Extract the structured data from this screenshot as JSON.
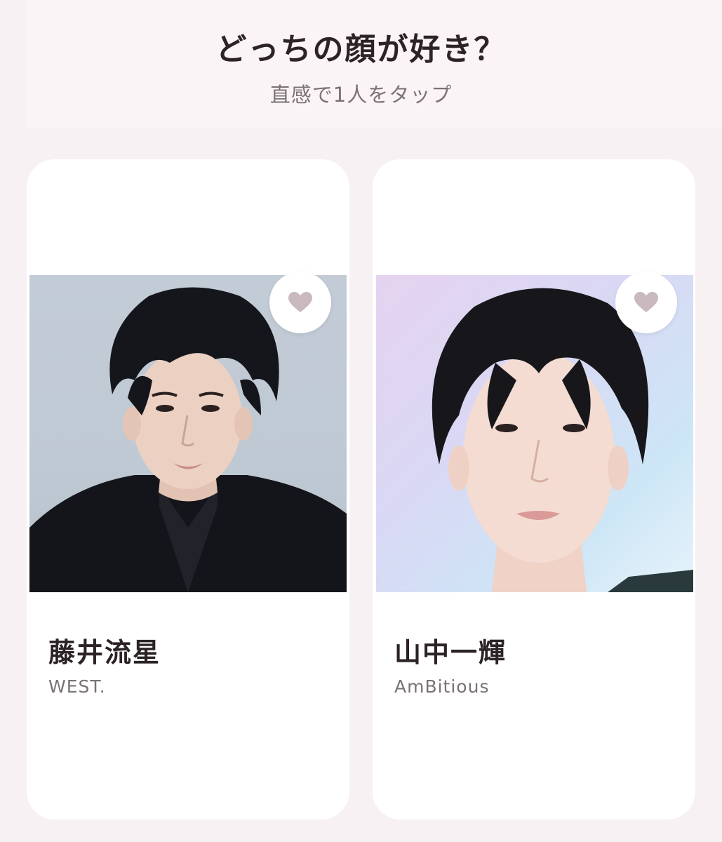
{
  "header": {
    "title": "どっちの顔が好き？",
    "subtitle": "直感で1人をタップ"
  },
  "candidates": [
    {
      "name": "藤井流星",
      "group": "WEST.",
      "favorite_icon": "heart-icon"
    },
    {
      "name": "山中一輝",
      "group": "AmBitious",
      "favorite_icon": "heart-icon"
    }
  ],
  "colors": {
    "background": "#f8f1f4",
    "card": "#ffffff",
    "heart": "#c9b9bf",
    "title": "#2b2326",
    "muted": "#7a7276"
  }
}
